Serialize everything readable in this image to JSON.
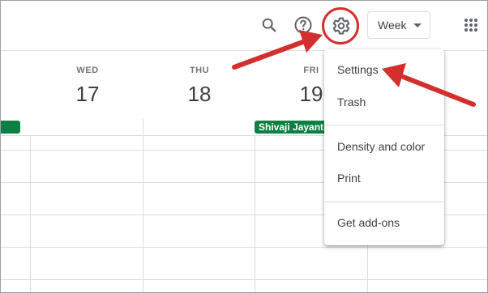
{
  "toolbar": {
    "view_selector": "Week"
  },
  "days": [
    {
      "name": "WED",
      "date": "17"
    },
    {
      "name": "THU",
      "date": "18"
    },
    {
      "name": "FRI",
      "date": "19"
    }
  ],
  "events": [
    {
      "title": ""
    },
    {
      "title": "Shivaji Jayanti"
    }
  ],
  "settings_menu": {
    "items": [
      {
        "label": "Settings"
      },
      {
        "label": "Trash"
      },
      {
        "label": "Density and color"
      },
      {
        "label": "Print"
      },
      {
        "label": "Get add-ons"
      }
    ]
  },
  "colors": {
    "annotation": "#d32f2f",
    "event": "#0b8043",
    "grid": "#dadce0"
  },
  "icons": [
    "search-icon",
    "help-icon",
    "gear-icon",
    "chevron-down-icon",
    "apps-grid-icon"
  ]
}
